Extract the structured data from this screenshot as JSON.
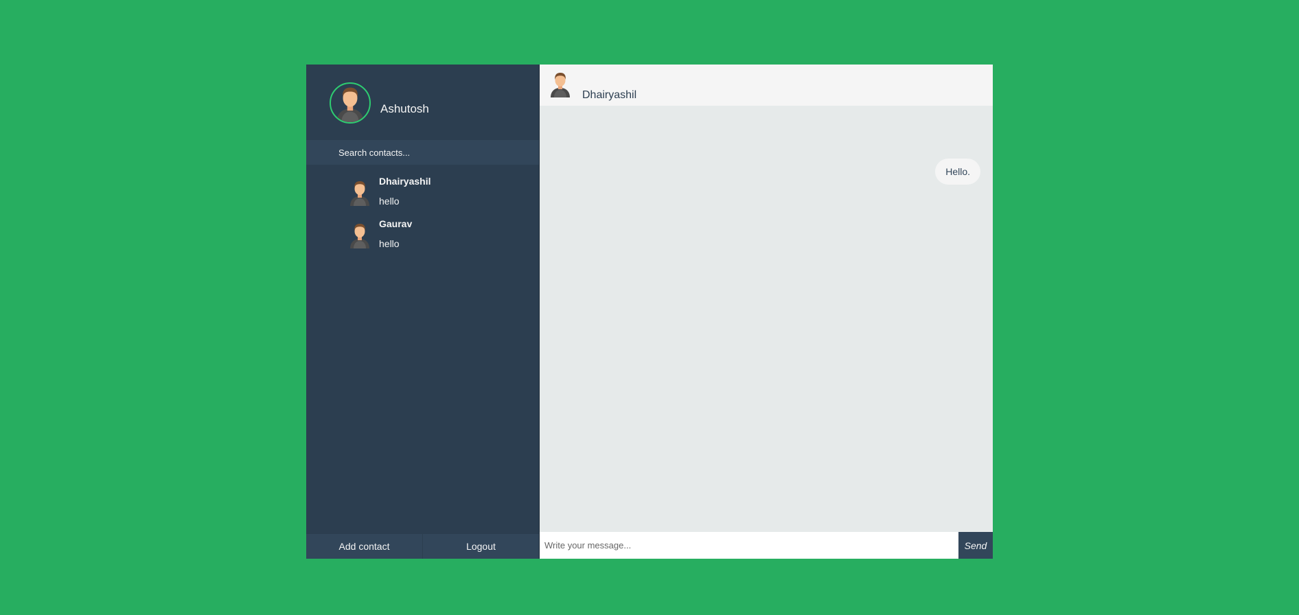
{
  "colors": {
    "background": "#27ae60",
    "sidebar": "#2c3e50",
    "sidebar_panel": "#32465a",
    "status_ring": "#2ecc71",
    "conversation": "#e6eaea",
    "header": "#f5f5f5"
  },
  "profile": {
    "name": "Ashutosh",
    "avatar_icon": "user-avatar-icon"
  },
  "search": {
    "placeholder": "Search contacts..."
  },
  "contacts": [
    {
      "name": "Dhairyashil",
      "preview": "hello",
      "avatar_icon": "user-avatar-icon"
    },
    {
      "name": "Gaurav",
      "preview": "hello",
      "avatar_icon": "user-avatar-icon"
    }
  ],
  "bottom_bar": {
    "add_contact_label": "Add contact",
    "logout_label": "Logout"
  },
  "conversation": {
    "contact_name": "Dhairyashil",
    "messages": [
      {
        "direction": "sent",
        "text": "Hello."
      }
    ]
  },
  "composer": {
    "placeholder": "Write your message...",
    "value": "",
    "send_label": "Send"
  }
}
